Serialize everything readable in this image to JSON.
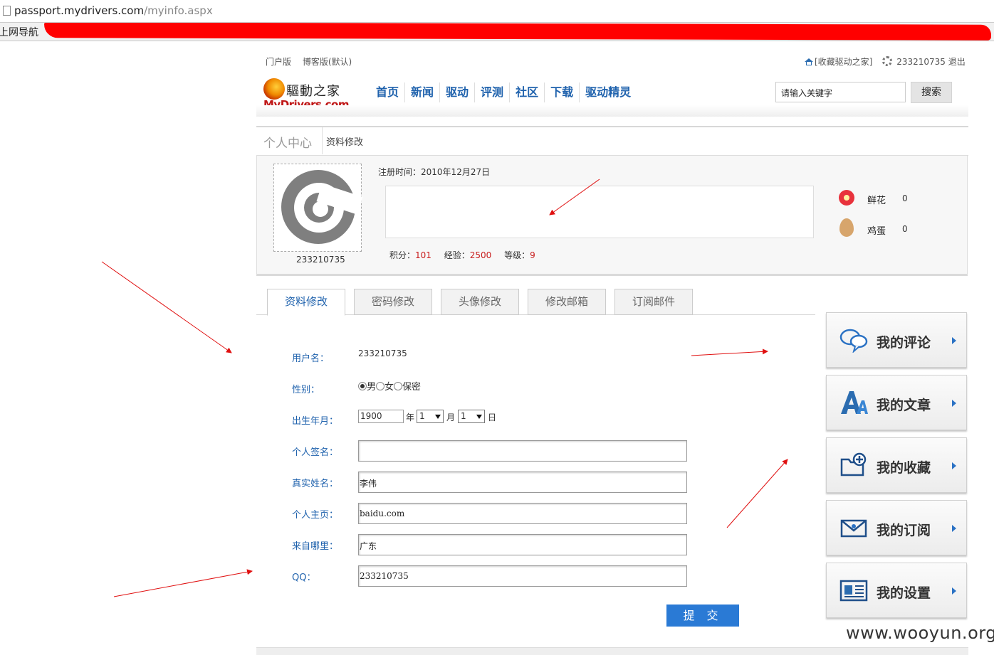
{
  "browser": {
    "url_host": "passport.mydrivers.com",
    "url_path": "/myinfo.aspx",
    "bookmark_label": "上网导航"
  },
  "top": {
    "links": [
      "门户版",
      "博客版(默认)"
    ],
    "favorite": "[收藏驱动之家]",
    "user": "233210735",
    "logout": "退出"
  },
  "logo": {
    "cn": "驅動之家",
    "en": "MyDrivers.com"
  },
  "nav": [
    "首页",
    "新闻",
    "驱动",
    "评测",
    "社区",
    "下载",
    "驱动精灵"
  ],
  "search": {
    "value": "请输入关键字",
    "button": "搜索"
  },
  "breadcrumb": {
    "title": "个人中心",
    "sub": "资料修改"
  },
  "profile": {
    "username": "233210735",
    "reg_label": "注册时间：",
    "reg_date": "2010年12月27日",
    "points_label": "积分：",
    "points": "101",
    "exp_label": "经验：",
    "exp": "2500",
    "level_label": "等级：",
    "level": "9",
    "flower_label": "鲜花",
    "flower_count": "0",
    "egg_label": "鸡蛋",
    "egg_count": "0"
  },
  "tabs": [
    "资料修改",
    "密码修改",
    "头像修改",
    "修改邮箱",
    "订阅邮件"
  ],
  "form": {
    "username_label": "用户名：",
    "username_value": "233210735",
    "gender_label": "性别：",
    "gender_options": [
      "男",
      "女",
      "保密"
    ],
    "birth_label": "出生年月：",
    "birth_year": "1900",
    "year_unit": "年",
    "birth_month": "1",
    "month_unit": "月",
    "birth_day": "1",
    "day_unit": "日",
    "signature_label": "个人签名：",
    "signature_value": "",
    "realname_label": "真实姓名：",
    "realname_value": "李伟",
    "homepage_label": "个人主页：",
    "homepage_value": "baidu.com",
    "from_label": "来自哪里：",
    "from_value": "广东",
    "qq_label": "QQ：",
    "qq_value": "233210735",
    "submit": "提 交"
  },
  "side_menu": [
    "我的评论",
    "我的文章",
    "我的收藏",
    "我的订阅",
    "我的设置"
  ],
  "watermark": "www.wooyun.org",
  "colors": {
    "link_blue": "#1f62ad",
    "accent_blue": "#2a7ad5",
    "red": "#c81c1c"
  }
}
